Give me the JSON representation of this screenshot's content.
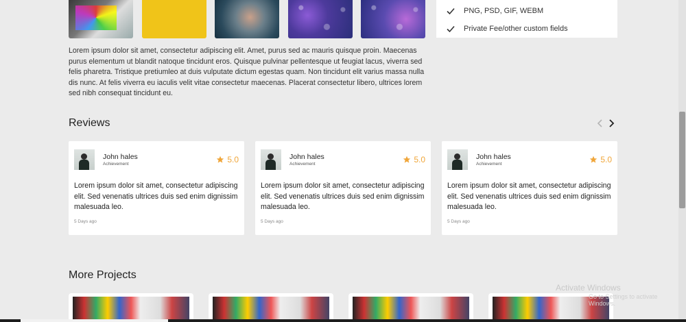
{
  "features": {
    "items": [
      {
        "label": "PNG, PSD, GIF, WEBM",
        "icon": "check-icon"
      },
      {
        "label": "Private Fee/other custom fields",
        "icon": "check-icon"
      }
    ]
  },
  "description": "Lorem ipsum dolor sit amet, consectetur adipiscing elit. Amet, purus sed ac mauris quisque proin. Maecenas purus elementum ut blandit natoque tincidunt eros. Quisque pulvinar pellentesque ut feugiat lacus, viverra sed felis pharetra. Tristique pretiumleo at duis vulputate dictum egestas quam. Non tincidunt elit varius massa nulla dis nunc. At felis viverra eu iaculis velit vitae consectetur maecenas. Placerat consectetur libero, ultrices lorem sed nibh consequat tincidunt eu.",
  "reviews": {
    "title": "Reviews",
    "items": [
      {
        "name": "John hales",
        "role": "Achievement",
        "rating": "5.0",
        "text": "Lorem ipsum dolor sit amet, consectetur adipiscing elit. Sed venenatis ultrices duis sed enim dignissim malesuada leo.",
        "time": "5 Days ago"
      },
      {
        "name": "John hales",
        "role": "Achievement",
        "rating": "5.0",
        "text": "Lorem ipsum dolor sit amet, consectetur adipiscing elit. Sed venenatis ultrices duis sed enim dignissim malesuada leo.",
        "time": "5 Days ago"
      },
      {
        "name": "John hales",
        "role": "Achievement",
        "rating": "5.0",
        "text": "Lorem ipsum dolor sit amet, consectetur adipiscing elit. Sed venenatis ultrices duis sed enim dignissim malesuada leo.",
        "time": "5 Days ago"
      }
    ]
  },
  "more_projects": {
    "title": "More Projects"
  },
  "watermark": {
    "line1": "Activate Windows",
    "line2": "Go to Settings to activate Windows."
  },
  "colors": {
    "accent_star": "#f0a63a",
    "background": "#ebebeb"
  }
}
